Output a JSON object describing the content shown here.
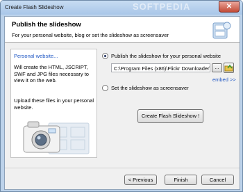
{
  "window": {
    "title": "Create Flash Slideshow",
    "watermark": "SOFTPEDIA",
    "close_glyph": "✕"
  },
  "header": {
    "title": "Publish the slideshow",
    "subtitle": "For your personal website, blog or set the slideshow as screensaver"
  },
  "left_panel": {
    "heading": "Personal website...",
    "description": "Will create the HTML, JSCRIPT, SWF and JPG files necessary to view it on the web.",
    "upload_note": "Upload these files in your personal website."
  },
  "options": {
    "publish_website_label": "Publish the slideshow for your personal website",
    "publish_website_selected": true,
    "output_path": "C:\\Program Files (x86)\\Flickr Downloader\\",
    "browse_label": "...",
    "embed_link": "embed >>",
    "screensaver_label": "Set the slideshow as screensaver",
    "screensaver_selected": false
  },
  "actions": {
    "create_label": "Create Flash Slideshow !"
  },
  "footer": {
    "previous_label": "< Previous",
    "finish_label": "Finish",
    "cancel_label": "Cancel"
  },
  "colors": {
    "frame": "#bcd2ea",
    "link": "#1d55c3",
    "close": "#c24a36"
  }
}
